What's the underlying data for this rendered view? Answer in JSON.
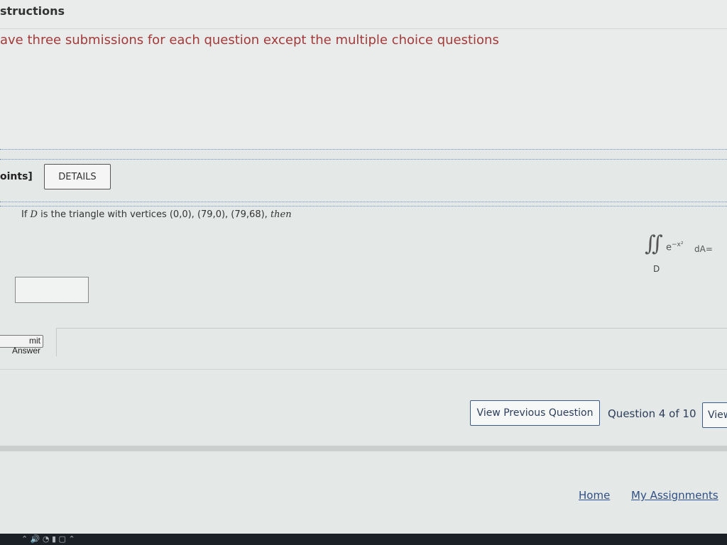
{
  "instructions": {
    "title": "structions",
    "body": "ave three submissions for each question except the multiple choice questions"
  },
  "question_header": {
    "points_label": "oints]",
    "details_button": "DETAILS"
  },
  "question": {
    "text_prefix": "If ",
    "var": "D",
    "text_suffix": " is the triangle with vertices (0,0), (79,0), (79,68), ",
    "then": "then",
    "integral": {
      "sign": "∬",
      "integrand_base": "e",
      "integrand_exponent": "−x²",
      "differential": "dA=",
      "region": "D"
    },
    "answer_value": ""
  },
  "submit": {
    "label": "mit Answer"
  },
  "navigation": {
    "prev_label": "View Previous Question",
    "counter": "Question 4 of 10",
    "next_label": "View Next Question"
  },
  "footer": {
    "home": "Home",
    "assignments": "My Assignments"
  },
  "taskbar": {
    "icons": "⌃  🔊  ◔  ▮  ▢  ⌃"
  }
}
